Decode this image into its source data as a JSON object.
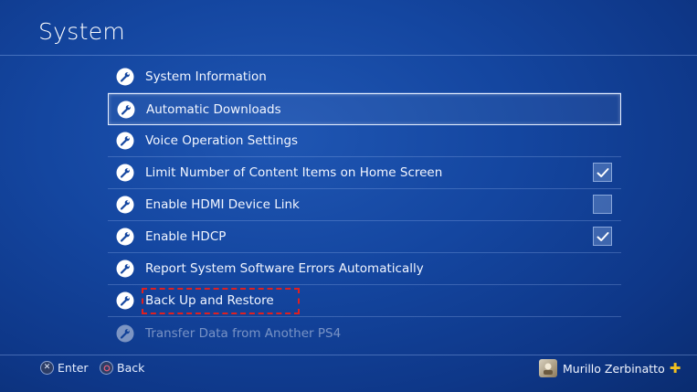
{
  "header": {
    "title": "System"
  },
  "menu": {
    "items": [
      {
        "label": "System Information",
        "icon": "wrench-icon"
      },
      {
        "label": "Automatic Downloads",
        "icon": "wrench-icon",
        "focused": true
      },
      {
        "label": "Voice Operation Settings",
        "icon": "wrench-icon"
      },
      {
        "label": "Limit Number of Content Items on Home Screen",
        "icon": "wrench-icon",
        "checkbox": true,
        "checked": true
      },
      {
        "label": "Enable HDMI Device Link",
        "icon": "wrench-icon",
        "checkbox": true,
        "checked": false
      },
      {
        "label": "Enable HDCP",
        "icon": "wrench-icon",
        "checkbox": true,
        "checked": true
      },
      {
        "label": "Report System Software Errors Automatically",
        "icon": "wrench-icon"
      },
      {
        "label": "Back Up and Restore",
        "icon": "wrench-icon",
        "annotated": true
      },
      {
        "label": "Transfer Data from Another PS4",
        "icon": "wrench-icon",
        "faded": true
      }
    ]
  },
  "footer": {
    "enter_label": "Enter",
    "back_label": "Back",
    "enter_icon": "cross-button-icon",
    "back_icon": "circle-button-icon"
  },
  "user": {
    "name": "Murillo Zerbinatto",
    "plus_badge": "PS Plus",
    "plus_color": "#f0c020"
  },
  "annotation": {
    "color": "#e02020"
  }
}
